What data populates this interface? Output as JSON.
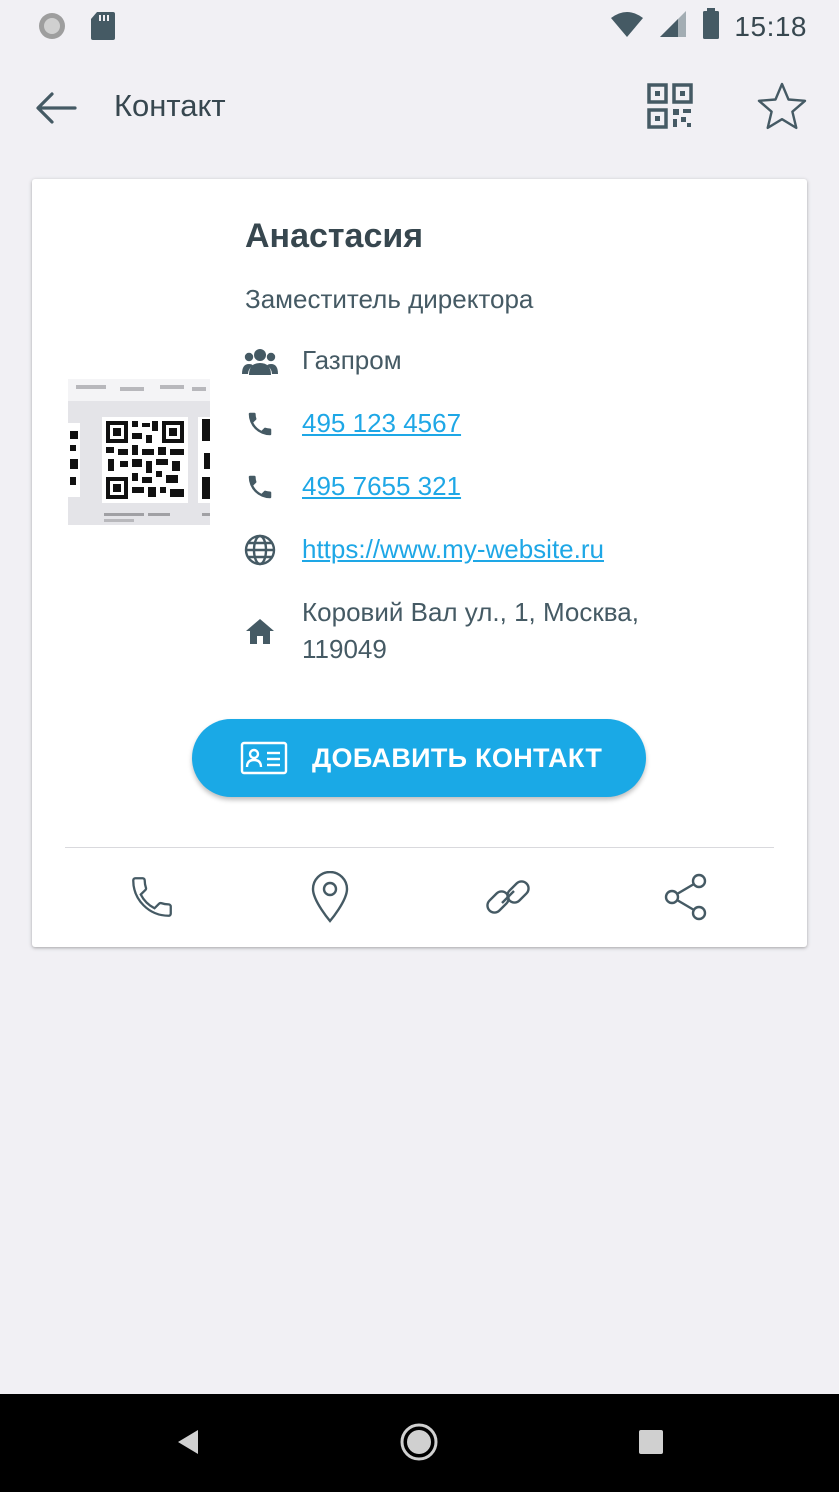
{
  "status_bar": {
    "time": "15:18",
    "icons": [
      "sync-icon",
      "sd-card-icon",
      "wifi-icon",
      "signal-icon",
      "battery-icon"
    ]
  },
  "app_bar": {
    "title": "Контакт",
    "icons": [
      "back-arrow-icon",
      "qr-code-icon",
      "star-icon"
    ]
  },
  "contact": {
    "name": "Анастасия",
    "job_title": "Заместитель директора",
    "company": "Газпром",
    "phones": [
      "495 123 4567",
      "495 7655 321"
    ],
    "website": "https://www.my-website.ru",
    "address_line1": "Коровий Вал ул., 1, Москва,",
    "address_line2": "119049"
  },
  "add_contact_button": {
    "label": "ДОБАВИТЬ КОНТАКТ"
  },
  "actions": [
    "phone-icon",
    "location-pin-icon",
    "link-icon",
    "share-icon"
  ],
  "colors": {
    "accent": "#1aa9e6",
    "link": "#1ea7e6",
    "text": "#37474f",
    "background": "#f1f0f4"
  }
}
